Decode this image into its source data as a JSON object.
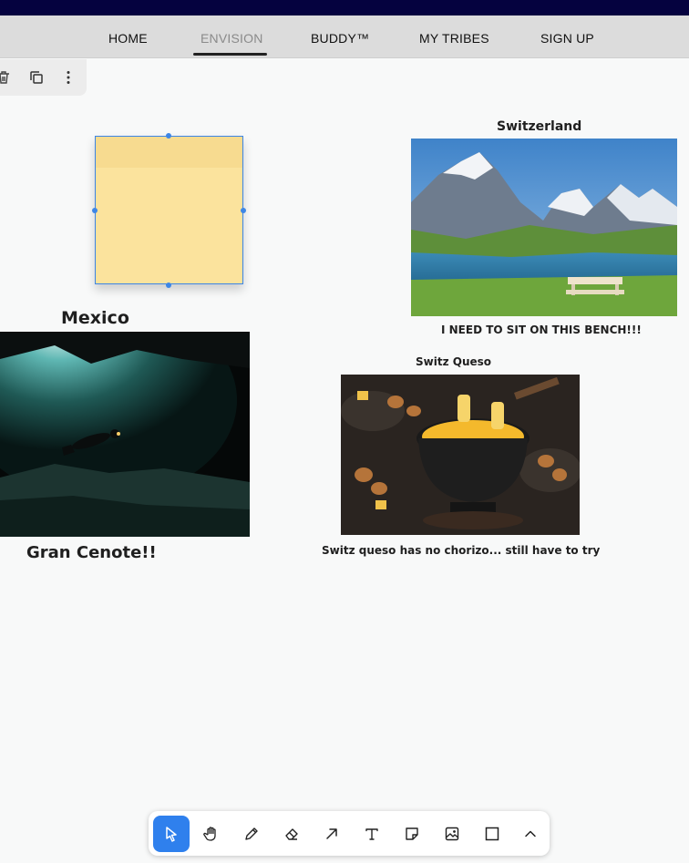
{
  "nav": {
    "items": [
      {
        "label": "HOME"
      },
      {
        "label": "ENVISION",
        "active": true
      },
      {
        "label": "BUDDY™"
      },
      {
        "label": "MY TRIBES"
      },
      {
        "label": "SIGN UP"
      }
    ]
  },
  "selection_toolbar": {
    "icons": [
      "trash-icon",
      "duplicate-icon",
      "more-vertical-icon"
    ]
  },
  "sticky_note": {
    "color": "#fbe39d",
    "text": ""
  },
  "canvas": {
    "switzerland_title": "Switzerland",
    "switzerland_caption": "I NEED TO SIT ON THIS BENCH!!!",
    "mexico_title": "Mexico",
    "mexico_caption": "Gran Cenote!!",
    "queso_title": "Switz Queso",
    "queso_caption": "Switz queso has no chorizo... still have to try"
  },
  "images": {
    "switzerland": "alpine lake with mountains and bench",
    "mexico": "scuba diver in underwater cenote cave",
    "queso": "cheese fondue pot with bread and potatoes"
  },
  "tools": [
    {
      "name": "select-tool",
      "icon": "cursor-icon",
      "active": true
    },
    {
      "name": "hand-tool",
      "icon": "hand-icon"
    },
    {
      "name": "pencil-tool",
      "icon": "pencil-icon"
    },
    {
      "name": "eraser-tool",
      "icon": "eraser-icon"
    },
    {
      "name": "arrow-tool",
      "icon": "arrow-icon"
    },
    {
      "name": "text-tool",
      "icon": "text-icon"
    },
    {
      "name": "note-tool",
      "icon": "sticky-note-icon"
    },
    {
      "name": "image-tool",
      "icon": "image-icon"
    },
    {
      "name": "rectangle-tool",
      "icon": "rectangle-icon"
    },
    {
      "name": "more-tools",
      "icon": "chevron-up-icon"
    }
  ],
  "colors": {
    "accent": "#2f80ed",
    "topbar": "#05023f",
    "nav_bg": "#dcdcdc"
  }
}
